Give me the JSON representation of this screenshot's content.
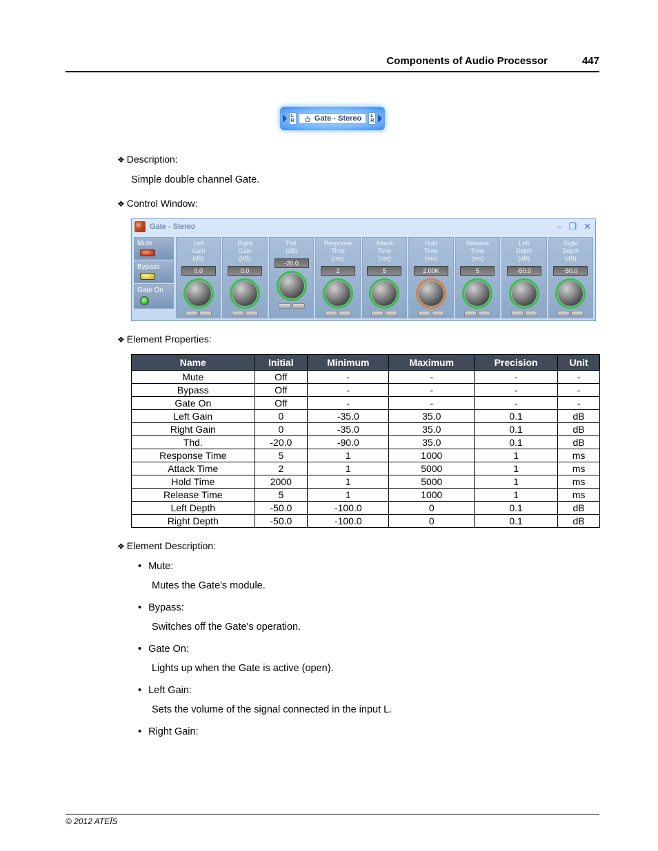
{
  "header": {
    "title": "Components of Audio Processor",
    "page": "447"
  },
  "icon": {
    "label": "Gate - Stereo",
    "lr": "L\nR"
  },
  "sections": {
    "description_label": "Description:",
    "description_text": "Simple double channel Gate.",
    "control_window_label": "Control Window:",
    "element_properties_label": "Element Properties:",
    "element_description_label": "Element Description:"
  },
  "control_window": {
    "title": "Gate - Stereo",
    "left_buttons": [
      {
        "label": "Mute",
        "led": "red"
      },
      {
        "label": "Bypass",
        "led": "yellow"
      },
      {
        "label": "Gate On",
        "led": "green"
      }
    ],
    "knobs": [
      {
        "head": "Left\nGain\n(dB)",
        "val": "0.0",
        "ring": "green"
      },
      {
        "head": "Right\nGain\n(dB)",
        "val": "0.0",
        "ring": "green"
      },
      {
        "head": "Thd.\n(dB)",
        "val": "-20.0",
        "ring": "green"
      },
      {
        "head": "Response\nTime\n(ms)",
        "val": "2",
        "ring": "green"
      },
      {
        "head": "Attack\nTime\n(ms)",
        "val": "5",
        "ring": "green"
      },
      {
        "head": "Hold\nTime\n(ms)",
        "val": "2.00K",
        "ring": "orange"
      },
      {
        "head": "Release\nTime\n(ms)",
        "val": "5",
        "ring": "green"
      },
      {
        "head": "Left\nDepth\n(dB)",
        "val": "-50.0",
        "ring": "green"
      },
      {
        "head": "Right\nDepth\n(dB)",
        "val": "-50.0",
        "ring": "green"
      }
    ]
  },
  "table": {
    "headers": [
      "Name",
      "Initial",
      "Minimum",
      "Maximum",
      "Precision",
      "Unit"
    ],
    "rows": [
      [
        "Mute",
        "Off",
        "-",
        "-",
        "-",
        "-"
      ],
      [
        "Bypass",
        "Off",
        "-",
        "-",
        "-",
        "-"
      ],
      [
        "Gate On",
        "Off",
        "-",
        "-",
        "-",
        "-"
      ],
      [
        "Left Gain",
        "0",
        "-35.0",
        "35.0",
        "0.1",
        "dB"
      ],
      [
        "Right Gain",
        "0",
        "-35.0",
        "35.0",
        "0.1",
        "dB"
      ],
      [
        "Thd.",
        "-20.0",
        "-90.0",
        "35.0",
        "0.1",
        "dB"
      ],
      [
        "Response Time",
        "5",
        "1",
        "1000",
        "1",
        "ms"
      ],
      [
        "Attack Time",
        "2",
        "1",
        "5000",
        "1",
        "ms"
      ],
      [
        "Hold Time",
        "2000",
        "1",
        "5000",
        "1",
        "ms"
      ],
      [
        "Release Time",
        "5",
        "1",
        "1000",
        "1",
        "ms"
      ],
      [
        "Left Depth",
        "-50.0",
        "-100.0",
        "0",
        "0.1",
        "dB"
      ],
      [
        "Right Depth",
        "-50.0",
        "-100.0",
        "0",
        "0.1",
        "dB"
      ]
    ]
  },
  "element_desc": [
    {
      "name": "Mute:",
      "body": "Mutes the Gate's module."
    },
    {
      "name": "Bypass:",
      "body": "Switches off the Gate's operation."
    },
    {
      "name": "Gate On:",
      "body": "Lights up when the Gate is active (open)."
    },
    {
      "name": "Left Gain:",
      "body": "Sets the volume of the signal connected in the input L."
    },
    {
      "name": "Right Gain:",
      "body": ""
    }
  ],
  "footer": "© 2012 ATEÏS",
  "glyphs": {
    "minimize": "–",
    "window": "❐",
    "close": "✕"
  }
}
